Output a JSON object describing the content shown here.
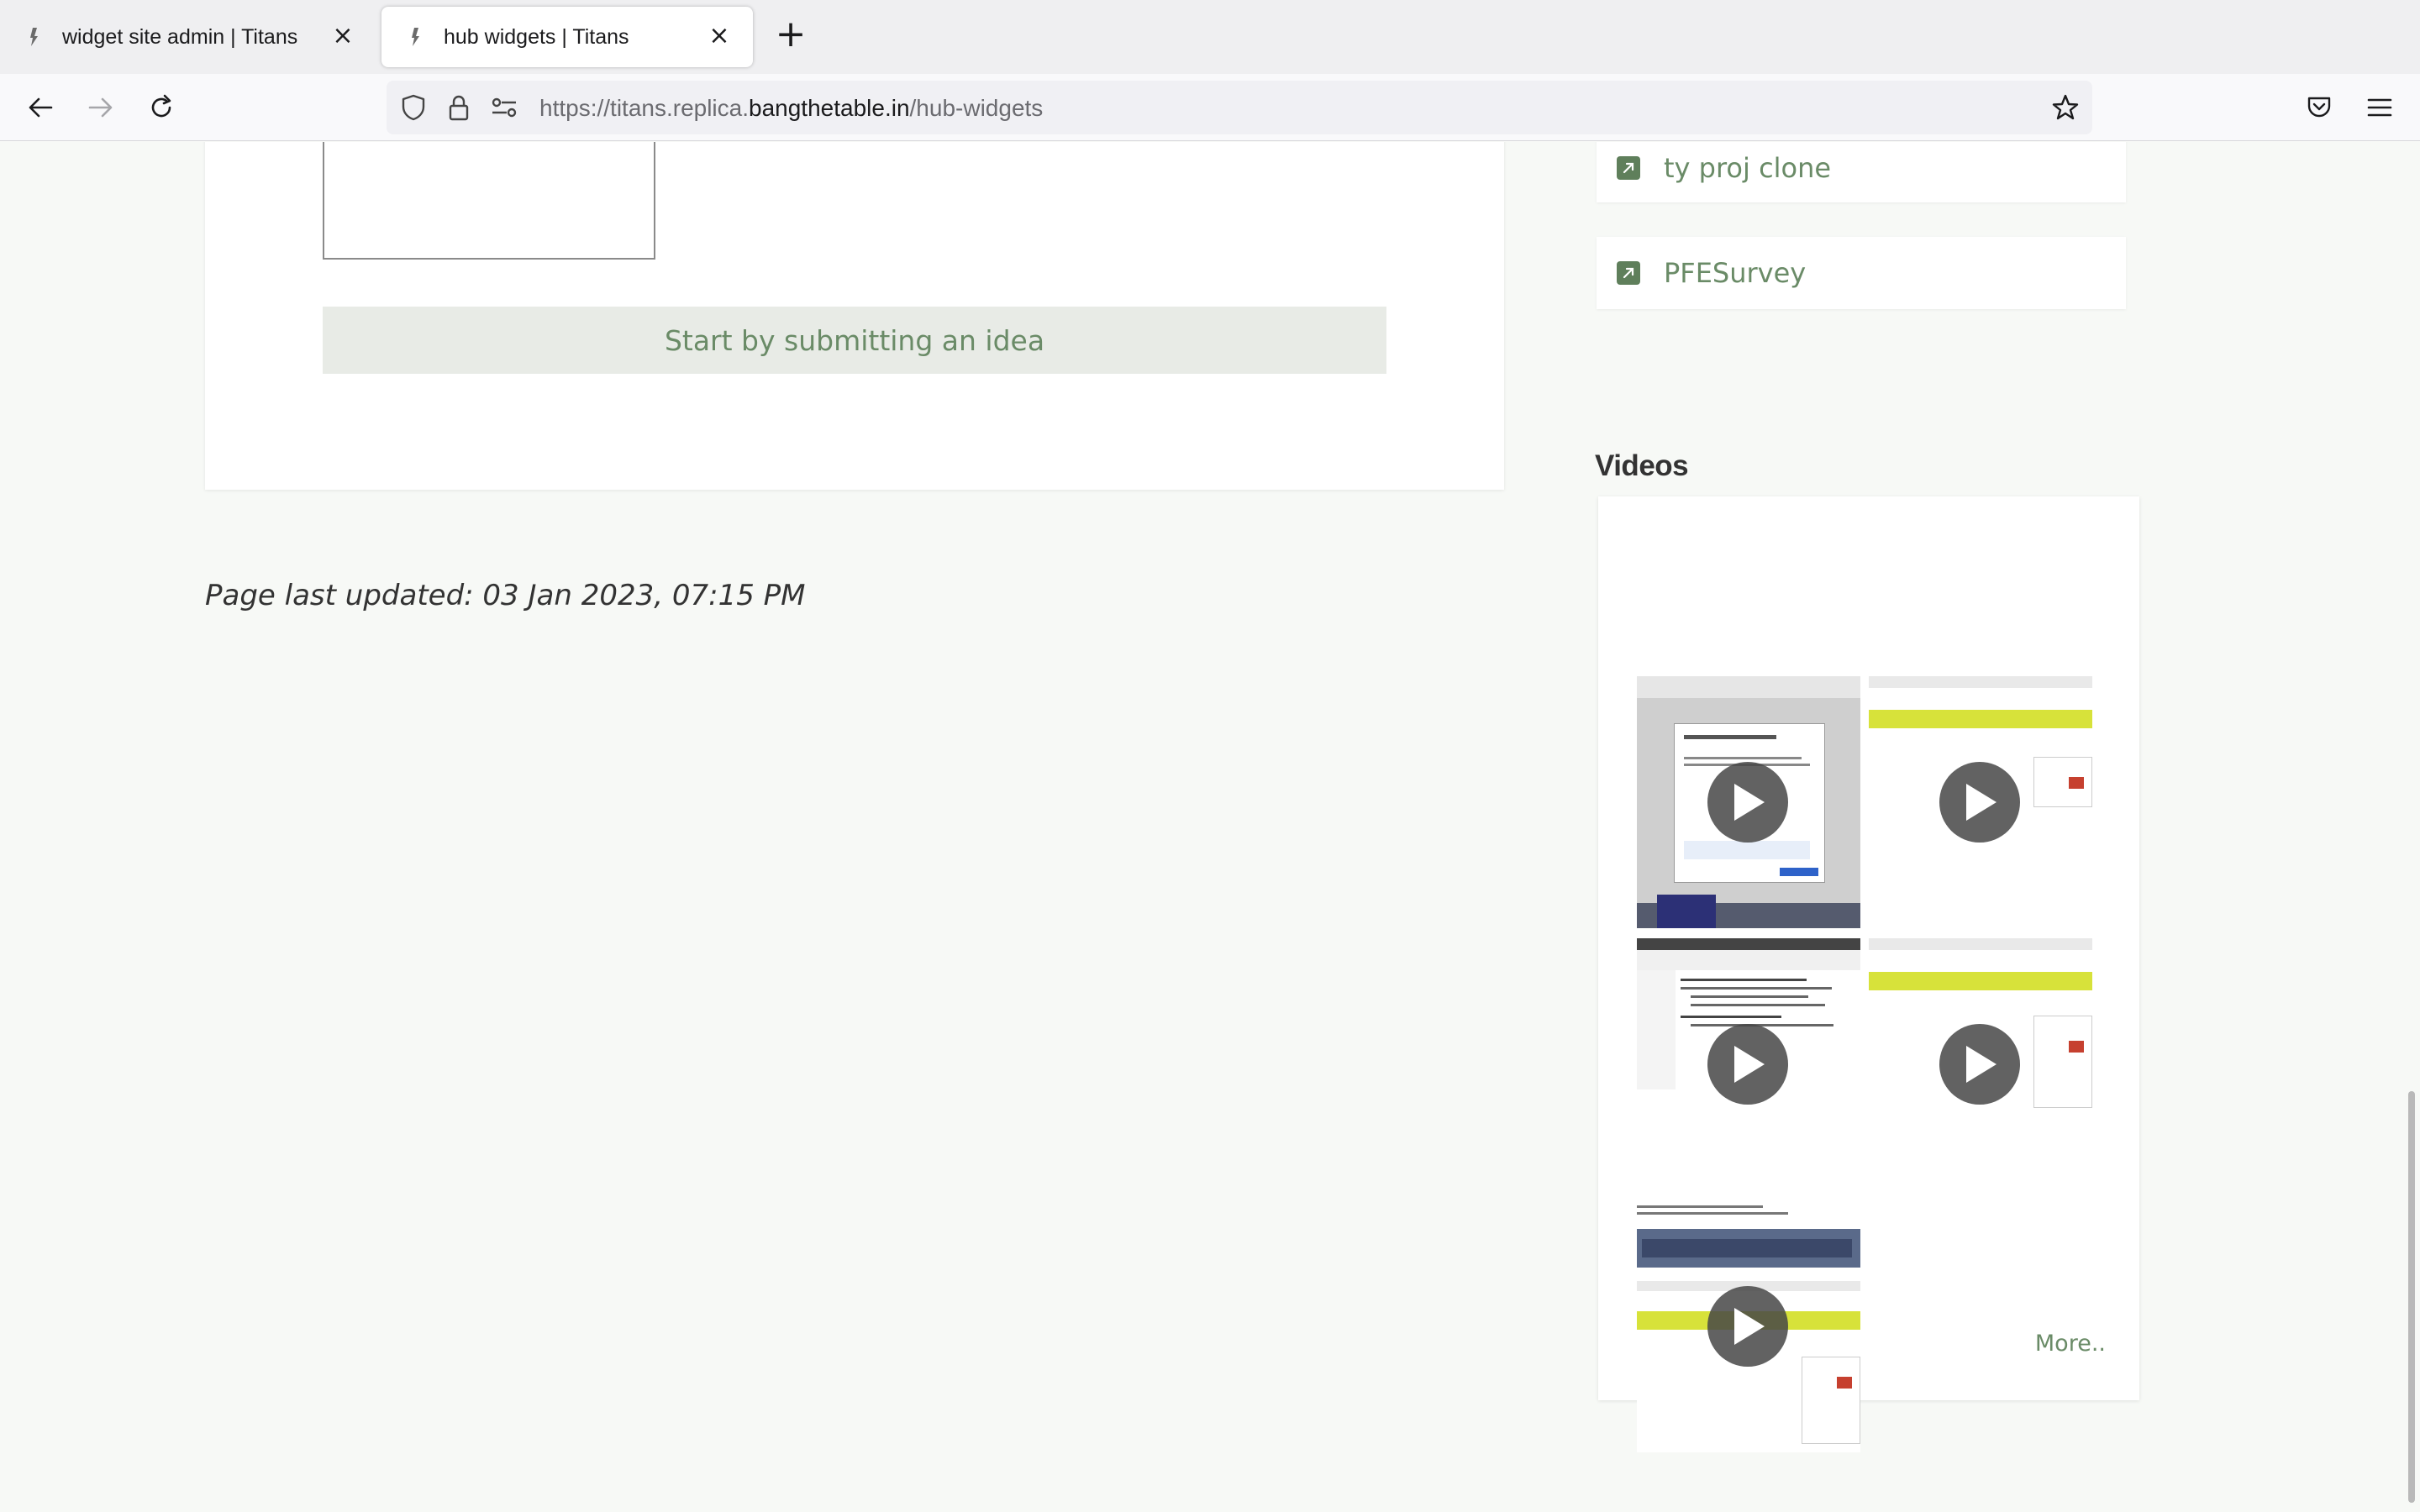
{
  "browser": {
    "tabs": [
      {
        "title": "widget site admin | Titans",
        "active": false
      },
      {
        "title": "hub widgets | Titans",
        "active": true
      }
    ],
    "url_prefix": "https://titans.replica.",
    "url_host": "bangthetable.in",
    "url_path": "/hub-widgets"
  },
  "content": {
    "idea_button_label": "Start by submitting an idea",
    "last_updated": "Page last updated: 03 Jan 2023, 07:15 PM"
  },
  "sidebar": {
    "project_links": [
      {
        "label": "ty proj clone",
        "icon": "external-link-icon"
      },
      {
        "label": "PFESurvey",
        "icon": "external-link-icon"
      }
    ],
    "videos_heading": "Videos",
    "videos_more": "More..",
    "video_count": 5
  },
  "colors": {
    "accent": "#6a8b67",
    "page_background": "#f7f9f6",
    "banner_yellow": "#d7e23a"
  }
}
